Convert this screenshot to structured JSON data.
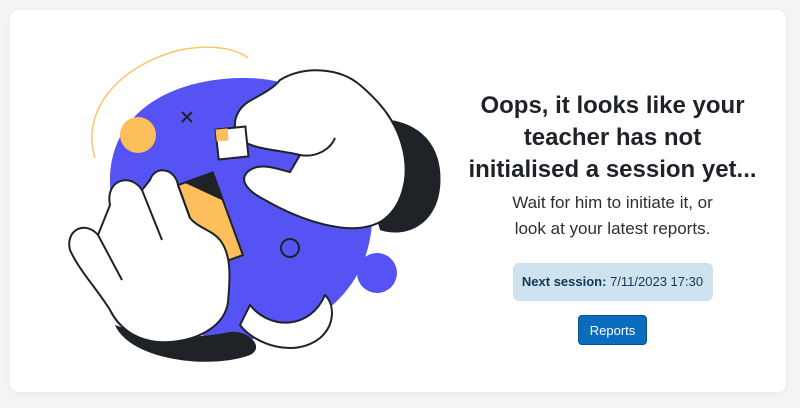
{
  "message": {
    "title_lines": [
      "Oops, it looks like your",
      "teacher has not",
      "initialised a session yet..."
    ],
    "subtitle_lines": [
      "Wait for him to initiate it, or",
      "look at your latest reports."
    ]
  },
  "next_session": {
    "label": "Next session:",
    "value": "7/11/2023 17:30"
  },
  "actions": {
    "reports_label": "Reports"
  },
  "colors": {
    "accent_blue": "#5653f5",
    "accent_yellow": "#fcbf5b",
    "dark": "#1f2328",
    "button": "#0a6cbc",
    "badge_bg": "#cfe2ef"
  }
}
